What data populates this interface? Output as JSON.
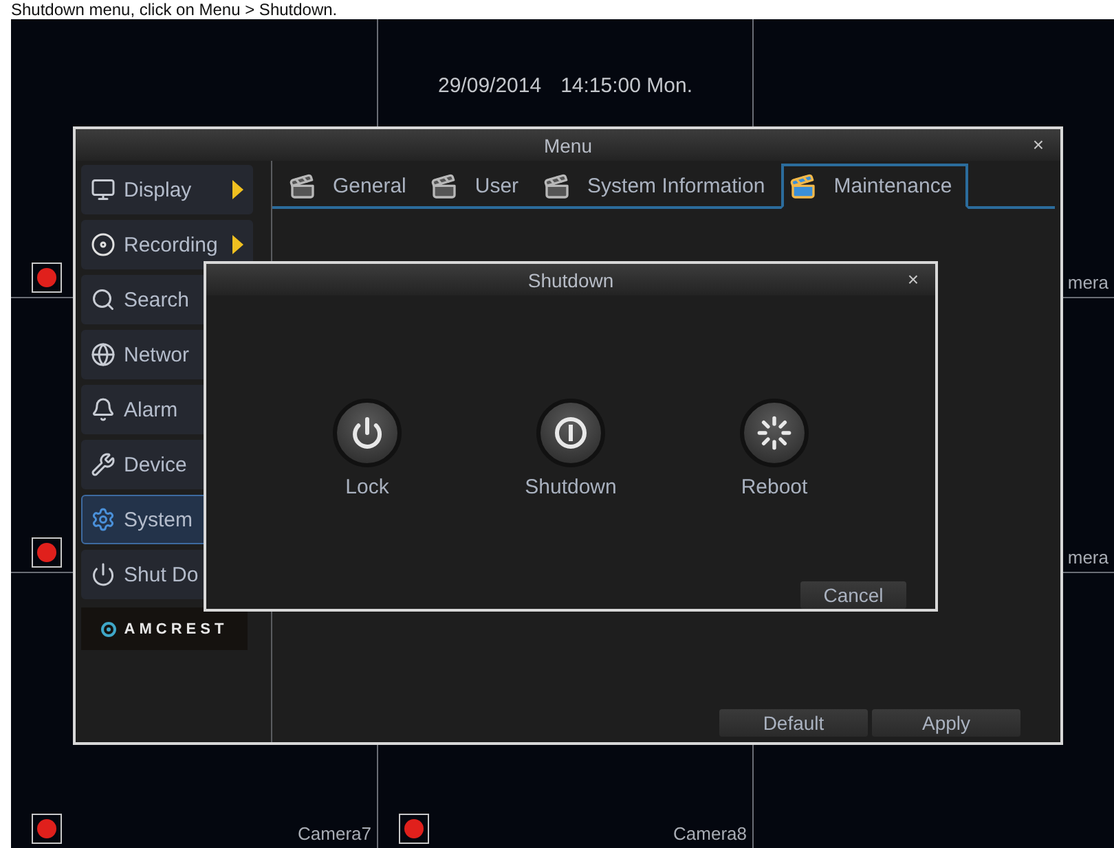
{
  "caption": "Shutdown menu, click on Menu > Shutdown.",
  "osd": {
    "date": "29/09/2014",
    "time": "14:15:00 Mon."
  },
  "cameras": [
    {
      "recording": true
    },
    {
      "label": "mera"
    },
    {
      "recording": true
    },
    {
      "label": "mera"
    },
    {
      "recording": true,
      "label": "Camera7"
    },
    {
      "recording": true,
      "label": "Camera8"
    }
  ],
  "menu": {
    "title": "Menu",
    "close": "×",
    "sidebar": [
      {
        "label": "Display",
        "submenu": true,
        "selected": false
      },
      {
        "label": "Recording",
        "submenu": true,
        "selected": false
      },
      {
        "label": "Search",
        "selected": false
      },
      {
        "label": "Networ",
        "selected": false
      },
      {
        "label": "Alarm",
        "selected": false
      },
      {
        "label": "Device",
        "selected": false
      },
      {
        "label": "System",
        "selected": true
      },
      {
        "label": "Shut Do",
        "selected": false
      }
    ],
    "logo": "AMCREST",
    "tabs": [
      {
        "label": "General",
        "selected": false
      },
      {
        "label": "User",
        "selected": false
      },
      {
        "label": "System Information",
        "selected": false
      },
      {
        "label": "Maintenance",
        "selected": true
      }
    ],
    "buttons": [
      "Default",
      "Apply"
    ]
  },
  "dialog": {
    "title": "Shutdown",
    "close": "×",
    "actions": [
      {
        "label": "Lock"
      },
      {
        "label": "Shutdown"
      },
      {
        "label": "Reboot"
      }
    ],
    "cancel": "Cancel"
  }
}
